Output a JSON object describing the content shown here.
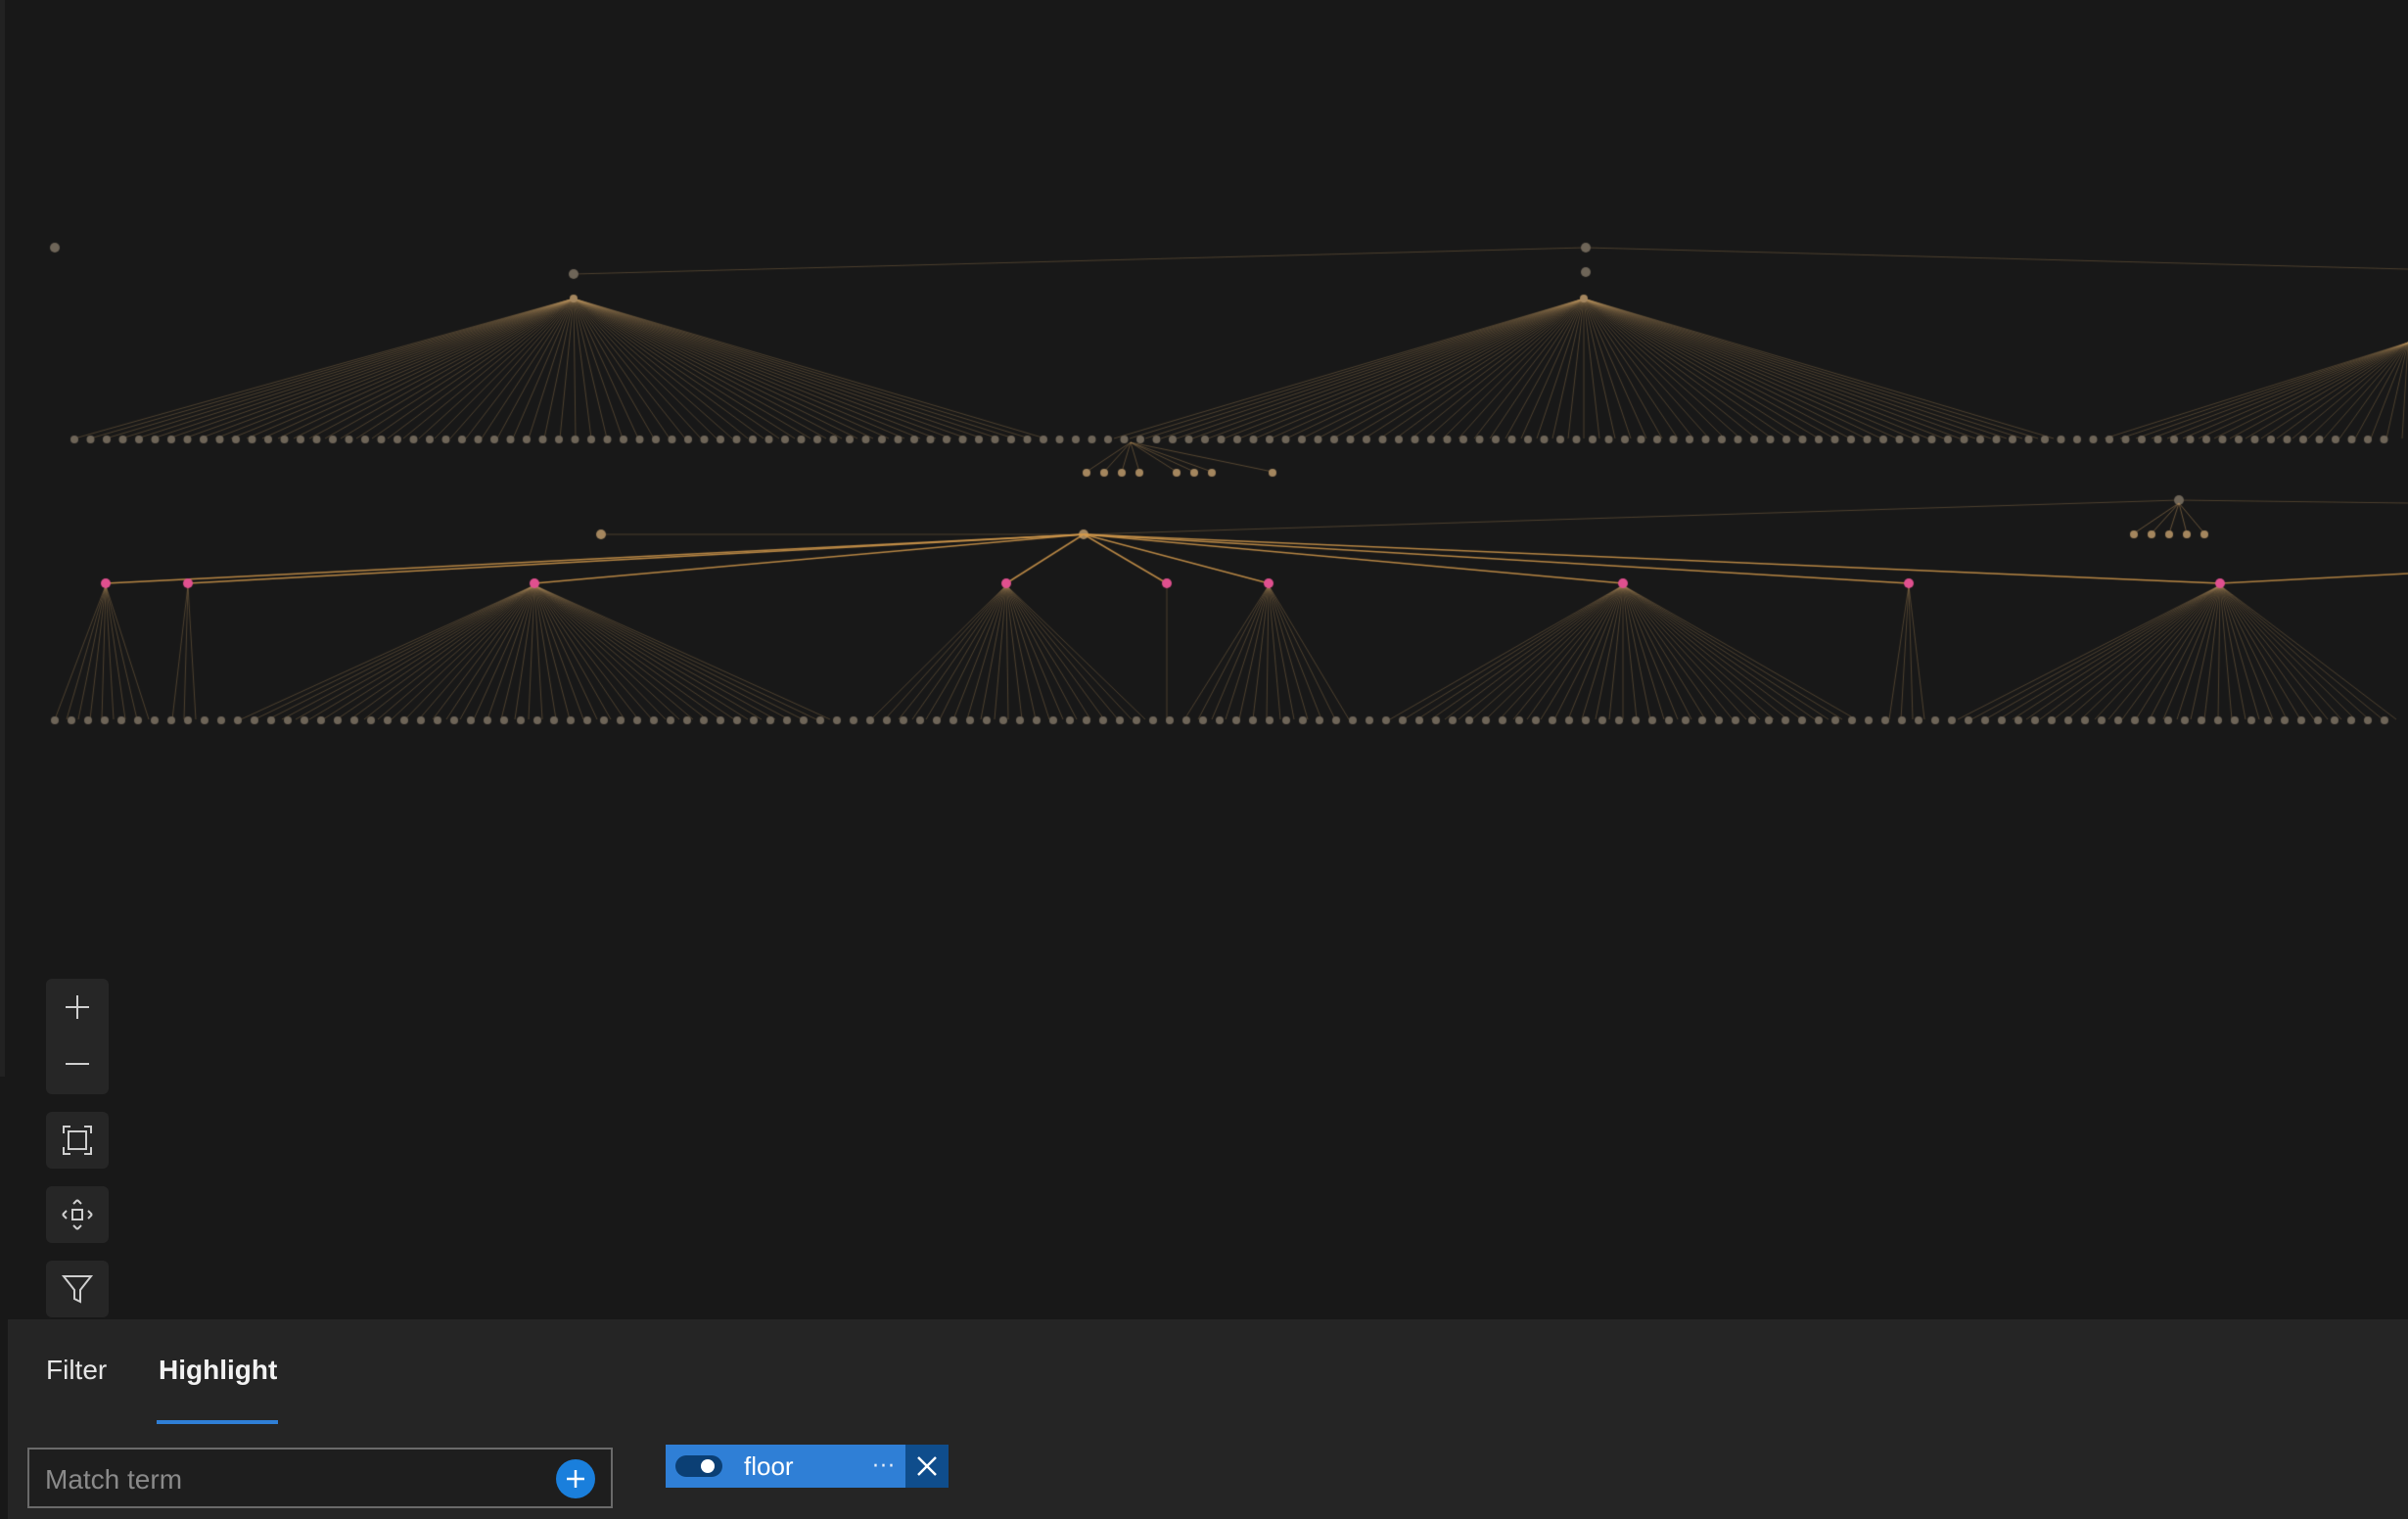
{
  "canvas": {
    "background": "#181818",
    "edge_color": "#b38b58",
    "highlight_edge_color": "#d39a4c",
    "node_color": "#6e6558",
    "root_node_color": "#a4865e",
    "highlighted_node_color": "#e0508f"
  },
  "toolbar": {
    "zoom_in_icon": "plus-icon",
    "zoom_out_icon": "minus-icon",
    "fit_icon": "fit-screen-icon",
    "center_icon": "center-move-icon",
    "filter_icon": "filter-funnel-icon"
  },
  "panel": {
    "tabs": [
      {
        "label": "Filter",
        "active": false
      },
      {
        "label": "Highlight",
        "active": true
      }
    ],
    "match_placeholder": "Match term",
    "add_icon": "plus-circle-icon",
    "chips": [
      {
        "label": "floor",
        "enabled": true,
        "more": "···",
        "close_icon": "close-icon"
      }
    ]
  }
}
